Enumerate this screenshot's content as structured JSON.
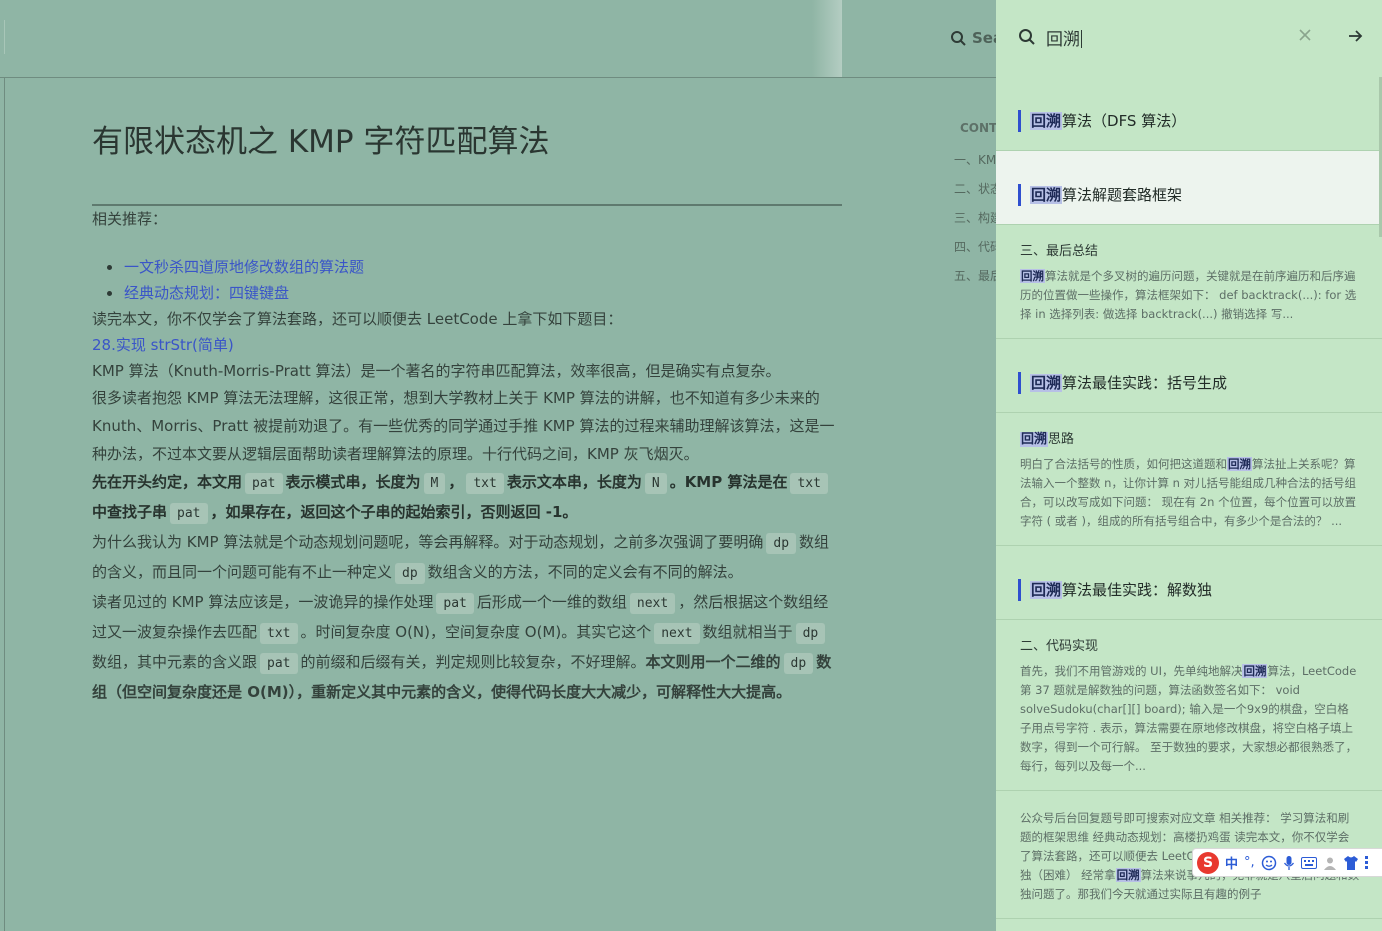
{
  "search_bar": {
    "placeholder": "Search"
  },
  "toc": {
    "heading": "CONTENTS",
    "items": [
      "一、KMP 算法概述",
      "二、状态机概述",
      "三、构建状态转移图",
      "四、代码实现",
      "五、最后总结"
    ]
  },
  "article": {
    "title": "有限状态机之 KMP 字符匹配算法",
    "recommend_label": "相关推荐：",
    "links": [
      "一文秒杀四道原地修改数组的算法题",
      "经典动态规划：四键键盘"
    ],
    "p1": "读完本文，你不仅学会了算法套路，还可以顺便去 LeetCode 上拿下如下题目：",
    "problem_link": "28.实现 strStr(简单)",
    "p2": "KMP 算法（Knuth-Morris-Pratt 算法）是一个著名的字符串匹配算法，效率很高，但是确实有点复杂。",
    "p3": "很多读者抱怨 KMP 算法无法理解，这很正常，想到大学教材上关于 KMP 算法的讲解，也不知道有多少未来的 Knuth、Morris、Pratt 被提前劝退了。有一些优秀的同学通过手推 KMP 算法的过程来辅助理解该算法，这是一种办法，不过本文要从逻辑层面帮助读者理解算法的原理。十行代码之间，KMP 灰飞烟灭。",
    "p4": {
      "a": "先在开头约定，本文用",
      "c1": "pat",
      "b": "表示模式串，长度为",
      "c2": "M",
      "sep1": "，",
      "c3": "txt",
      "d": "表示文本串，长度为",
      "c4": "N",
      "e": "。KMP 算法是在",
      "c5": "txt",
      "f": "中查找子串",
      "c6": "pat",
      "g": "，如果存在，返回这个子串的起始索引，否则返回 -1。"
    },
    "p5": {
      "a": "为什么我认为 KMP 算法就是个动态规划问题呢，等会再解释。对于动态规划，之前多次强调了要明确",
      "c1": "dp",
      "b": "数组的含义，而且同一个问题可能有不止一种定义",
      "c2": "dp",
      "c": "数组含义的方法，不同的定义会有不同的解法。"
    },
    "p6": {
      "a": "读者见过的 KMP 算法应该是，一波诡异的操作处理",
      "c1": "pat",
      "b": "后形成一个一维的数组",
      "c2": "next",
      "c": "，然后根据这个数组经过又一波复杂操作去匹配",
      "c3": "txt",
      "d": "。时间复杂度 O(N)，空间复杂度 O(M)。其实它这个",
      "c4": "next",
      "e": "数组就相当于",
      "c5": "dp",
      "f": "数组，其中元素的含义跟",
      "c6": "pat",
      "g": "的前缀和后缀有关，判定规则比较复杂，不好理解。",
      "bold1": "本文则用一个二维的",
      "c7": "dp",
      "bold2": "数组（但空间复杂度还是 O(M)），重新定义其中元素的含义，使得代码长度大大减少，可解释性大大提高。"
    }
  },
  "search_panel": {
    "query": "回溯",
    "results": [
      {
        "hl": "回溯",
        "rest": "算法（DFS 算法）"
      },
      {
        "hl": "回溯",
        "rest": "算法解题套路框架"
      },
      {
        "section": "三、最后总结",
        "snippet_hl": "回溯",
        "snippet": "算法就是个多叉树的遍历问题，关键就是在前序遍历和后序遍历的位置做一些操作，算法框架如下： def backtrack(...): for 选择 in 选择列表: 做选择 backtrack(...) 撤销选择 写..."
      },
      {
        "hl": "回溯",
        "rest": "算法最佳实践：括号生成"
      },
      {
        "section_hl": "回溯",
        "section_rest": "思路",
        "snippet_a": "明白了合法括号的性质，如何把这道题和",
        "snippet_hl": "回溯",
        "snippet_b": "算法扯上关系呢？算法输入一个整数 n，让你计算 n 对儿括号能组成几种合法的括号组合，可以改写成如下问题： 现在有 2n 个位置，每个位置可以放置字符 ( 或者 )，组成的所有括号组合中，有多少个是合法的？ ..."
      },
      {
        "hl": "回溯",
        "rest": "算法最佳实践：解数独"
      },
      {
        "section": "二、代码实现",
        "snippet_a": "首先，我们不用管游戏的 UI，先单纯地解决",
        "snippet_hl": "回溯",
        "snippet_b": "算法，LeetCode 第 37 题就是解数独的问题，算法函数签名如下： void solveSudoku(char[][] board); 输入是一个9x9的棋盘，空白格子用点号字符 . 表示，算法需要在原地修改棋盘，将空白格子填上数字，得到一个可行解。 至于数独的要求，大家想必都很熟悉了，每行，每列以及每一个..."
      },
      {
        "snippet_a": "公众号后台回复题号即可搜索对应文章 相关推荐： 学习算法和刷题的框架思维 经典动态规划：高楼扔鸡蛋 读完本文，你不仅学会了算法套路，还可以顺便去 LeetCode 上拿下如下题目： 37.解数独（困难） 经常拿",
        "snippet_hl": "回溯",
        "snippet_b": "算法来说事儿的，无非就是八皇后问题和数独问题了。那我们今天就通过实际且有趣的例子"
      }
    ]
  },
  "ime_toolbar": {
    "logo": "S",
    "lang": "中",
    "punct": "°,"
  }
}
